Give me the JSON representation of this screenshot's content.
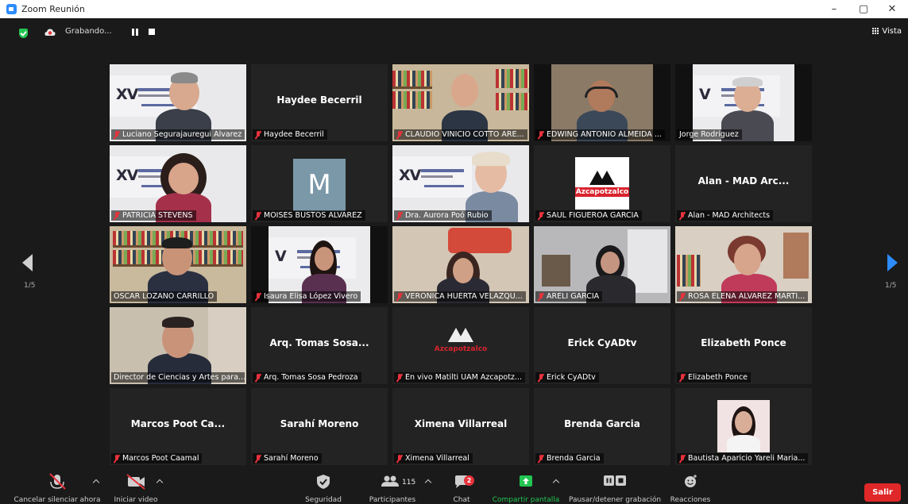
{
  "window": {
    "title": "Zoom Reunión",
    "controls": [
      "–",
      "▢",
      "✕"
    ]
  },
  "topbar": {
    "recording_label": "Grabando...",
    "view_label": "Vista"
  },
  "pagination": {
    "left": "1/5",
    "right": "1/5"
  },
  "participants": [
    {
      "label": "Luciano Segurajauregui Alvarez",
      "muted": true,
      "kind": "video"
    },
    {
      "label": "Haydee Becerril",
      "display": "Haydee Becerril",
      "muted": true,
      "kind": "name"
    },
    {
      "label": "CLAUDIO VINICIO COTTO ARE...",
      "muted": true,
      "kind": "video"
    },
    {
      "label": "EDWING ANTONIO ALMEIDA ...",
      "muted": true,
      "kind": "video"
    },
    {
      "label": "Jorge Rodriguez",
      "muted": false,
      "kind": "video"
    },
    {
      "label": "PATRICIA STEVENS",
      "muted": true,
      "kind": "video"
    },
    {
      "label": "MOISES BUSTOS ALVAREZ",
      "avatar": "M",
      "muted": true,
      "kind": "avatar"
    },
    {
      "label": "Dra. Aurora Poó Rubio",
      "muted": true,
      "kind": "video"
    },
    {
      "label": "SAUL FIGUEROA GARCIA",
      "logo_text": "Azcapotzalco",
      "muted": true,
      "kind": "logo"
    },
    {
      "label": "Alan - MAD Architects",
      "display": "Alan - MAD Arc...",
      "muted": true,
      "kind": "name"
    },
    {
      "label": "OSCAR LOZANO CARRILLO",
      "muted": false,
      "kind": "video",
      "active": true
    },
    {
      "label": "Isaura Elisa López Vivero",
      "muted": true,
      "kind": "video"
    },
    {
      "label": "VERONICA HUERTA VELAZQU...",
      "muted": true,
      "kind": "video"
    },
    {
      "label": "ARELI GARCIA",
      "muted": true,
      "kind": "video"
    },
    {
      "label": "ROSA ELENA ALVAREZ MARTI...",
      "muted": true,
      "kind": "video"
    },
    {
      "label": "Director de Ciencias y Artes para...",
      "muted": false,
      "kind": "video"
    },
    {
      "label": "Arq. Tomas Sosa Pedroza",
      "display": "Arq. Tomas Sosa...",
      "muted": true,
      "kind": "name"
    },
    {
      "label": "En vivo Matilti UAM Azcapotz...",
      "logo_text": "Azcapotzalco",
      "muted": true,
      "kind": "logo"
    },
    {
      "label": "Erick CyADtv",
      "display": "Erick CyADtv",
      "muted": true,
      "kind": "name"
    },
    {
      "label": "Elizabeth Ponce",
      "display": "Elizabeth Ponce",
      "muted": true,
      "kind": "name"
    },
    {
      "label": "Marcos Poot Caamal",
      "display": "Marcos Poot Ca...",
      "muted": true,
      "kind": "name"
    },
    {
      "label": "Sarahí Moreno",
      "display": "Sarahí Moreno",
      "muted": true,
      "kind": "name"
    },
    {
      "label": "Ximena Villarreal",
      "display": "Ximena Villarreal",
      "muted": true,
      "kind": "name"
    },
    {
      "label": "Brenda Garcia",
      "display": "Brenda Garcia",
      "muted": true,
      "kind": "name"
    },
    {
      "label": "Bautista Aparicio Yareli Maria...",
      "muted": true,
      "kind": "photo"
    }
  ],
  "toolbar": {
    "mute_label": "Cancelar silenciar ahora",
    "video_label": "Iniciar video",
    "security_label": "Seguridad",
    "participants_label": "Participantes",
    "participants_count": "115",
    "chat_label": "Chat",
    "chat_badge": "2",
    "share_label": "Compartir pantalla",
    "record_label": "Pausar/detener grabación",
    "reactions_label": "Reacciones",
    "leave_label": "Salir"
  },
  "colors": {
    "accent": "#2d8cff",
    "share_green": "#23c552",
    "mute_red": "#e8323c",
    "active_speaker": "#d6ff3b",
    "leave_red": "#e02828"
  }
}
